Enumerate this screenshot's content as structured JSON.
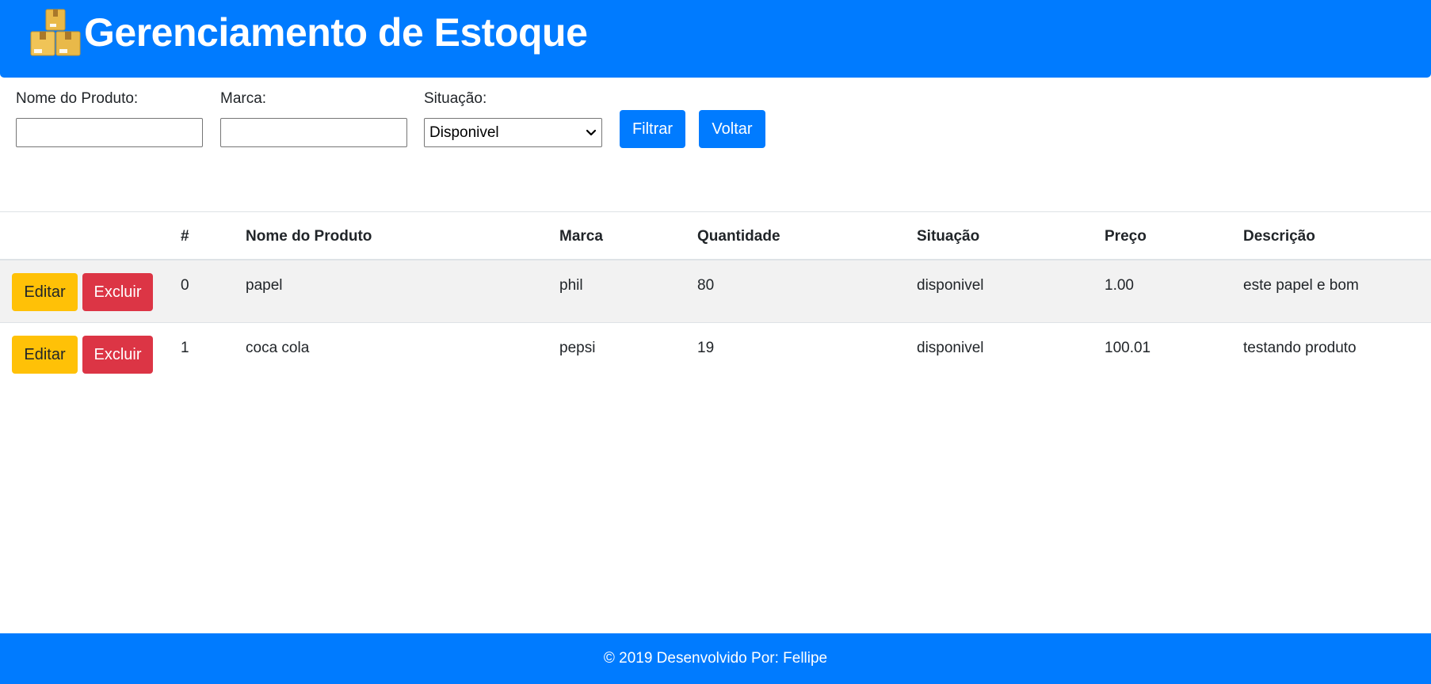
{
  "header": {
    "title": "Gerenciamento de Estoque",
    "logo_icon": "boxes-icon",
    "background_color": "#007bff"
  },
  "filters": {
    "product_name_label": "Nome do Produto:",
    "product_name_value": "",
    "brand_label": "Marca:",
    "brand_value": "",
    "status_label": "Situação:",
    "status_selected": "Disponivel",
    "filter_button": "Filtrar",
    "back_button": "Voltar"
  },
  "table": {
    "columns": [
      "#",
      "Nome do Produto",
      "Marca",
      "Quantidade",
      "Situação",
      "Preço",
      "Descrição"
    ],
    "edit_label": "Editar",
    "delete_label": "Excluir",
    "rows": [
      {
        "id": "0",
        "name": "papel",
        "brand": "phil",
        "quantity": "80",
        "status": "disponivel",
        "price": "1.00",
        "description": "este papel e bom"
      },
      {
        "id": "1",
        "name": "coca cola",
        "brand": "pepsi",
        "quantity": "19",
        "status": "disponivel",
        "price": "100.01",
        "description": "testando produto"
      }
    ]
  },
  "footer": {
    "text": "© 2019 Desenvolvido Por: Fellipe"
  },
  "colors": {
    "primary": "#007bff",
    "warning": "#ffc107",
    "danger": "#dc3545",
    "striped_row": "#f2f2f2"
  }
}
